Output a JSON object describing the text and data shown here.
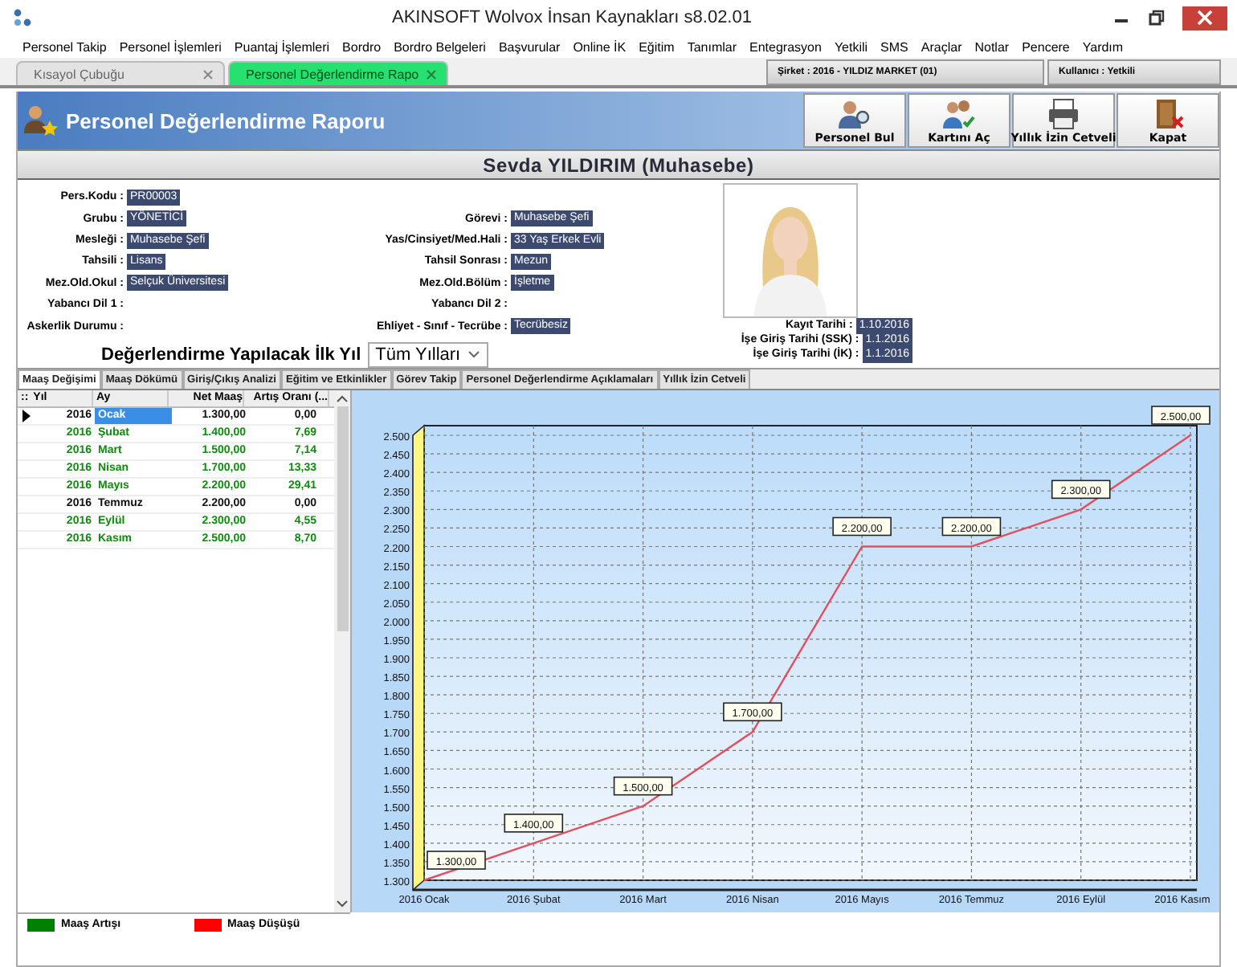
{
  "window": {
    "title": "AKINSOFT Wolvox İnsan Kaynakları s8.02.01"
  },
  "menu": [
    "Personel Takip",
    "Personel İşlemleri",
    "Puantaj İşlemleri",
    "Bordro",
    "Bordro Belgeleri",
    "Başvurular",
    "Online İK",
    "Eğitim",
    "Tanımlar",
    "Entegrasyon",
    "Yetkili",
    "SMS",
    "Araçlar",
    "Notlar",
    "Pencere",
    "Yardım"
  ],
  "doc_tabs": [
    {
      "label": "Kısayol Çubuğu",
      "selected": false
    },
    {
      "label": "Personel Değerlendirme Rapo",
      "selected": true
    }
  ],
  "company": "Şirket : 2016 - YILDIZ MARKET (01)",
  "user": "Kullanıcı : Yetkili",
  "page_title": "Personel Değerlendirme Raporu",
  "toolbar": [
    {
      "label": "Personel Bul",
      "kind": "find"
    },
    {
      "label": "Kartını Aç",
      "kind": "card"
    },
    {
      "label": "Yıllık İzin Cetveli",
      "kind": "print"
    },
    {
      "label": "Kapat",
      "kind": "exit"
    }
  ],
  "employee_name": "Sevda YILDIRIM (Muhasebe)",
  "info_rows": [
    {
      "left": {
        "label": "Pers.Kodu :",
        "value": "PR00003"
      }
    },
    {
      "left": {
        "label": "Grubu :",
        "value": "YÖNETİCİ"
      },
      "right": {
        "label": "Görevi :",
        "value": "Muhasebe Şefi"
      }
    },
    {
      "left": {
        "label": "Mesleği :",
        "value": "Muhasebe Şefi"
      },
      "right": {
        "label": "Yas/Cinsiyet/Med.Hali :",
        "value": "33 Yaş Erkek Evli"
      }
    },
    {
      "left": {
        "label": "Tahsili :",
        "value": "Lisans"
      },
      "right": {
        "label": "Tahsil Sonrası :",
        "value": "Mezun"
      }
    },
    {
      "left": {
        "label": "Mez.Old.Okul :",
        "value": "Selçuk Üniversitesi"
      },
      "right": {
        "label": "Mez.Old.Bölüm :",
        "value": "İşletme"
      }
    },
    {
      "left": {
        "label": "Yabancı Dil 1 :"
      },
      "right": {
        "label": "Yabancı Dil 2 :"
      }
    },
    {
      "left": {
        "label": "Askerlik Durumu :"
      },
      "right": {
        "label": "Ehliyet - Sınıf - Tecrübe :",
        "value": "Tecrübesiz"
      }
    }
  ],
  "start_year": {
    "label": "Değerlendirme Yapılacak İlk Yıl",
    "value": "Tüm Yılları"
  },
  "dates": [
    {
      "label": "Kayıt Tarihi :",
      "value": "1.10.2016"
    },
    {
      "label": "İşe Giriş Tarihi (SSK) :",
      "value": "1.1.2016"
    },
    {
      "label": "İşe Giriş Tarihi (İK) :",
      "value": "1.1.2016"
    }
  ],
  "report_tabs": [
    {
      "label": "Maaş Değişimi",
      "selected": true
    },
    {
      "label": "Maaş Dökümü",
      "selected": false
    },
    {
      "label": "Giriş/Çıkış Analizi",
      "selected": false
    },
    {
      "label": "Eğitim ve Etkinlikler",
      "selected": false
    },
    {
      "label": "Görev Takip",
      "selected": false
    },
    {
      "label": "Personel Değerlendirme Açıklamaları",
      "selected": false
    },
    {
      "label": "Yıllık İzin Cetveli",
      "selected": false
    }
  ],
  "table": {
    "corner": "::",
    "columns": [
      "Yıl",
      "Ay",
      "Net Maaş",
      "Artış Oranı (..."
    ],
    "rows": [
      {
        "cells": [
          "2016",
          "Ocak",
          "1.300,00",
          "0,00"
        ],
        "increase": false,
        "selected": true
      },
      {
        "cells": [
          "2016",
          "Şubat",
          "1.400,00",
          "7,69"
        ],
        "increase": true,
        "selected": false
      },
      {
        "cells": [
          "2016",
          "Mart",
          "1.500,00",
          "7,14"
        ],
        "increase": true,
        "selected": false
      },
      {
        "cells": [
          "2016",
          "Nisan",
          "1.700,00",
          "13,33"
        ],
        "increase": true,
        "selected": false
      },
      {
        "cells": [
          "2016",
          "Mayıs",
          "2.200,00",
          "29,41"
        ],
        "increase": true,
        "selected": false
      },
      {
        "cells": [
          "2016",
          "Temmuz",
          "2.200,00",
          "0,00"
        ],
        "increase": false,
        "selected": false
      },
      {
        "cells": [
          "2016",
          "Eylül",
          "2.300,00",
          "4,55"
        ],
        "increase": true,
        "selected": false
      },
      {
        "cells": [
          "2016",
          "Kasım",
          "2.500,00",
          "8,70"
        ],
        "increase": true,
        "selected": false
      }
    ]
  },
  "legend": [
    {
      "label": "Maaş Artışı",
      "color": "#008000"
    },
    {
      "label": "Maaş Düşüşü",
      "color": "#ff0000"
    }
  ],
  "chart": {
    "chart_data": {
      "type": "line",
      "categories": [
        "2016 Ocak",
        "2016 Şubat",
        "2016 Mart",
        "2016 Nisan",
        "2016 Mayıs",
        "2016 Temmuz",
        "2016 Eylül",
        "2016 Kasım"
      ],
      "series": [
        {
          "color": "#e05060",
          "values": [
            1300,
            1400,
            1500,
            1700,
            2200,
            2200,
            2300,
            2500
          ]
        }
      ],
      "ylim": [
        1300,
        2500
      ],
      "yticks": [
        {
          "value": 1300,
          "label": "1.300"
        },
        {
          "value": 1350,
          "label": "1.350"
        },
        {
          "value": 1400,
          "label": "1.400"
        },
        {
          "value": 1450,
          "label": "1.450"
        },
        {
          "value": 1500,
          "label": "1.500"
        },
        {
          "value": 1550,
          "label": "1.550"
        },
        {
          "value": 1600,
          "label": "1.600"
        },
        {
          "value": 1650,
          "label": "1.650"
        },
        {
          "value": 1700,
          "label": "1.700"
        },
        {
          "value": 1750,
          "label": "1.750"
        },
        {
          "value": 1800,
          "label": "1.800"
        },
        {
          "value": 1850,
          "label": "1.850"
        },
        {
          "value": 1900,
          "label": "1.900"
        },
        {
          "value": 1950,
          "label": "1.950"
        },
        {
          "value": 2000,
          "label": "2.000"
        },
        {
          "value": 2050,
          "label": "2.050"
        },
        {
          "value": 2100,
          "label": "2.100"
        },
        {
          "value": 2150,
          "label": "2.150"
        },
        {
          "value": 2200,
          "label": "2.200"
        },
        {
          "value": 2250,
          "label": "2.250"
        },
        {
          "value": 2300,
          "label": "2.300"
        },
        {
          "value": 2350,
          "label": "2.350"
        },
        {
          "value": 2400,
          "label": "2.400"
        },
        {
          "value": 2450,
          "label": "2.450"
        },
        {
          "value": 2500,
          "label": "2.500"
        }
      ],
      "grid": true,
      "value_labels": [
        "1.300,00",
        "1.400,00",
        "1.500,00",
        "1.700,00",
        "2.200,00",
        "2.200,00",
        "2.300,00",
        "2.500,00"
      ]
    }
  }
}
